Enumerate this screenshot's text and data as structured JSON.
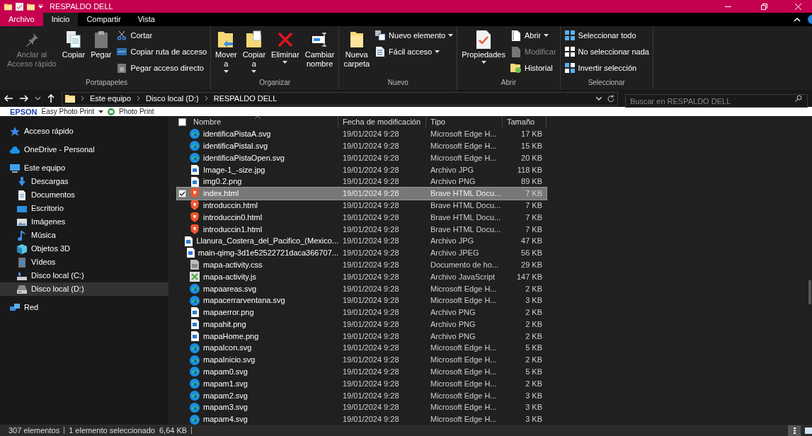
{
  "window": {
    "title": "RESPALDO DELL"
  },
  "tabs": [
    {
      "label": "Archivo",
      "selected": false,
      "kind": "file"
    },
    {
      "label": "Inicio",
      "selected": true,
      "kind": "tab"
    },
    {
      "label": "Compartir",
      "selected": false,
      "kind": "tab"
    },
    {
      "label": "Vista",
      "selected": false,
      "kind": "tab"
    }
  ],
  "ribbon": {
    "groups": [
      {
        "label": "Portapapeles",
        "items": [
          {
            "kind": "large",
            "label": "Anclar al\nAcceso rápido",
            "dropdown": false,
            "disabled": true
          },
          {
            "kind": "large",
            "label": "Copiar",
            "dropdown": false,
            "disabled": false
          },
          {
            "kind": "large",
            "label": "Pegar",
            "dropdown": false,
            "disabled": false
          },
          {
            "kind": "stack",
            "items": [
              {
                "label": "Cortar",
                "dropdown": false,
                "disabled": false
              },
              {
                "label": "Copiar ruta de acceso",
                "dropdown": false,
                "disabled": false
              },
              {
                "label": "Pegar acceso directo",
                "dropdown": false,
                "disabled": false
              }
            ]
          }
        ]
      },
      {
        "label": "Organizar",
        "items": [
          {
            "kind": "large",
            "label": "Mover\na",
            "dropdown": true,
            "disabled": false
          },
          {
            "kind": "large",
            "label": "Copiar\na",
            "dropdown": true,
            "disabled": false
          },
          {
            "kind": "large",
            "label": "Eliminar",
            "dropdown": true,
            "disabled": false
          },
          {
            "kind": "large",
            "label": "Cambiar\nnombre",
            "dropdown": false,
            "disabled": false
          }
        ]
      },
      {
        "label": "Nuevo",
        "items": [
          {
            "kind": "large",
            "label": "Nueva\ncarpeta",
            "dropdown": false,
            "disabled": false
          },
          {
            "kind": "stack",
            "items": [
              {
                "label": "Nuevo elemento",
                "dropdown": true,
                "disabled": false
              },
              {
                "label": "Fácil acceso",
                "dropdown": true,
                "disabled": false
              }
            ]
          }
        ]
      },
      {
        "label": "Abrir",
        "items": [
          {
            "kind": "large",
            "label": "Propiedades",
            "dropdown": true,
            "disabled": false
          },
          {
            "kind": "stack",
            "items": [
              {
                "label": "Abrir",
                "dropdown": true,
                "disabled": false
              },
              {
                "label": "Modificar",
                "dropdown": false,
                "disabled": true
              },
              {
                "label": "Historial",
                "dropdown": false,
                "disabled": false
              }
            ]
          }
        ]
      },
      {
        "label": "Seleccionar",
        "items": [
          {
            "kind": "stack",
            "items": [
              {
                "label": "Seleccionar todo",
                "dropdown": false,
                "disabled": false
              },
              {
                "label": "No seleccionar nada",
                "dropdown": false,
                "disabled": false
              },
              {
                "label": "Invertir selección",
                "dropdown": false,
                "disabled": false
              }
            ]
          }
        ]
      }
    ]
  },
  "address": {
    "path": [
      "Este equipo",
      "Disco local (D:)",
      "RESPALDO DELL"
    ],
    "search_placeholder": "Buscar en RESPALDO DELL"
  },
  "epson_bar": {
    "brand": "EPSON",
    "app": "Easy Photo Print",
    "tool": "Photo Print"
  },
  "sidebar": {
    "items": [
      {
        "label": "Acceso rápido",
        "kind": "star",
        "selected": false
      },
      {
        "label": "OneDrive - Personal",
        "kind": "cloud",
        "selected": false
      },
      {
        "label": "Este equipo",
        "kind": "pc",
        "selected": false,
        "children": [
          {
            "label": "Descargas",
            "kind": "download",
            "selected": false
          },
          {
            "label": "Documentos",
            "kind": "docs",
            "selected": false
          },
          {
            "label": "Escritorio",
            "kind": "desktop",
            "selected": false
          },
          {
            "label": "Imágenes",
            "kind": "pictures",
            "selected": false
          },
          {
            "label": "Música",
            "kind": "music",
            "selected": false
          },
          {
            "label": "Objetos 3D",
            "kind": "cube",
            "selected": false
          },
          {
            "label": "Vídeos",
            "kind": "videos",
            "selected": false
          },
          {
            "label": "Disco local (C:)",
            "kind": "drive_c",
            "selected": false
          },
          {
            "label": "Disco local (D:)",
            "kind": "drive",
            "selected": true
          }
        ]
      },
      {
        "label": "Red",
        "kind": "network",
        "selected": false
      }
    ]
  },
  "table": {
    "all_checked": false,
    "columns": [
      "Nombre",
      "Fecha de modificación",
      "Tipo",
      "Tamaño"
    ],
    "rows": [
      {
        "name": "identificaPistaA.svg",
        "date": "19/01/2024 9:28",
        "type": "Microsoft Edge H...",
        "size": "17 KB",
        "kind": "edge",
        "selected": false
      },
      {
        "name": "identificaPistaI.svg",
        "date": "19/01/2024 9:28",
        "type": "Microsoft Edge H...",
        "size": "15 KB",
        "kind": "edge",
        "selected": false
      },
      {
        "name": "identificaPistaOpen.svg",
        "date": "19/01/2024 9:28",
        "type": "Microsoft Edge H...",
        "size": "20 KB",
        "kind": "edge",
        "selected": false
      },
      {
        "name": "Image-1_-size.jpg",
        "date": "19/01/2024 9:28",
        "type": "Archivo JPG",
        "size": "118 KB",
        "kind": "image",
        "selected": false
      },
      {
        "name": "img0.2.png",
        "date": "19/01/2024 9:28",
        "type": "Archivo PNG",
        "size": "89 KB",
        "kind": "image",
        "selected": false
      },
      {
        "name": "index.html",
        "date": "19/01/2024 9:28",
        "type": "Brave HTML Docu...",
        "size": "7 KB",
        "kind": "brave",
        "selected": true
      },
      {
        "name": "introduccin.html",
        "date": "19/01/2024 9:28",
        "type": "Brave HTML Docu...",
        "size": "7 KB",
        "kind": "brave",
        "selected": false
      },
      {
        "name": "introduccin0.html",
        "date": "19/01/2024 9:28",
        "type": "Brave HTML Docu...",
        "size": "7 KB",
        "kind": "brave",
        "selected": false
      },
      {
        "name": "introduccin1.html",
        "date": "19/01/2024 9:28",
        "type": "Brave HTML Docu...",
        "size": "7 KB",
        "kind": "brave",
        "selected": false
      },
      {
        "name": "Llanura_Costera_del_Pacifico_(Mexico...",
        "date": "19/01/2024 9:28",
        "type": "Archivo JPG",
        "size": "47 KB",
        "kind": "image",
        "selected": false
      },
      {
        "name": "main-qimg-3d1e52522721daca366707...",
        "date": "19/01/2024 9:28",
        "type": "Archivo JPEG",
        "size": "56 KB",
        "kind": "image",
        "selected": false
      },
      {
        "name": "mapa-activity.css",
        "date": "19/01/2024 9:28",
        "type": "Documento de ho...",
        "size": "29 KB",
        "kind": "css",
        "selected": false
      },
      {
        "name": "mapa-activity.js",
        "date": "19/01/2024 9:28",
        "type": "Archivo JavaScript",
        "size": "147 KB",
        "kind": "js",
        "selected": false
      },
      {
        "name": "mapaareas.svg",
        "date": "19/01/2024 9:28",
        "type": "Microsoft Edge H...",
        "size": "2 KB",
        "kind": "edge",
        "selected": false
      },
      {
        "name": "mapacerrarventana.svg",
        "date": "19/01/2024 9:28",
        "type": "Microsoft Edge H...",
        "size": "3 KB",
        "kind": "edge",
        "selected": false
      },
      {
        "name": "mapaerror.png",
        "date": "19/01/2024 9:28",
        "type": "Archivo PNG",
        "size": "2 KB",
        "kind": "image",
        "selected": false
      },
      {
        "name": "mapahit.png",
        "date": "19/01/2024 9:28",
        "type": "Archivo PNG",
        "size": "2 KB",
        "kind": "image",
        "selected": false
      },
      {
        "name": "mapaHome.png",
        "date": "19/01/2024 9:28",
        "type": "Archivo PNG",
        "size": "2 KB",
        "kind": "image",
        "selected": false
      },
      {
        "name": "mapaIcon.svg",
        "date": "19/01/2024 9:28",
        "type": "Microsoft Edge H...",
        "size": "5 KB",
        "kind": "edge",
        "selected": false
      },
      {
        "name": "mapaInicio.svg",
        "date": "19/01/2024 9:28",
        "type": "Microsoft Edge H...",
        "size": "2 KB",
        "kind": "edge",
        "selected": false
      },
      {
        "name": "mapam0.svg",
        "date": "19/01/2024 9:28",
        "type": "Microsoft Edge H...",
        "size": "5 KB",
        "kind": "edge",
        "selected": false
      },
      {
        "name": "mapam1.svg",
        "date": "19/01/2024 9:28",
        "type": "Microsoft Edge H...",
        "size": "2 KB",
        "kind": "edge",
        "selected": false
      },
      {
        "name": "mapam2.svg",
        "date": "19/01/2024 9:28",
        "type": "Microsoft Edge H...",
        "size": "3 KB",
        "kind": "edge",
        "selected": false
      },
      {
        "name": "mapam3.svg",
        "date": "19/01/2024 9:28",
        "type": "Microsoft Edge H...",
        "size": "3 KB",
        "kind": "edge",
        "selected": false
      },
      {
        "name": "mapam4.svg",
        "date": "19/01/2024 9:28",
        "type": "Microsoft Edge H...",
        "size": "3 KB",
        "kind": "edge",
        "selected": false
      }
    ]
  },
  "status_bar": {
    "count": "307 elementos",
    "selection": "1 elemento seleccionado  6,64 KB"
  }
}
